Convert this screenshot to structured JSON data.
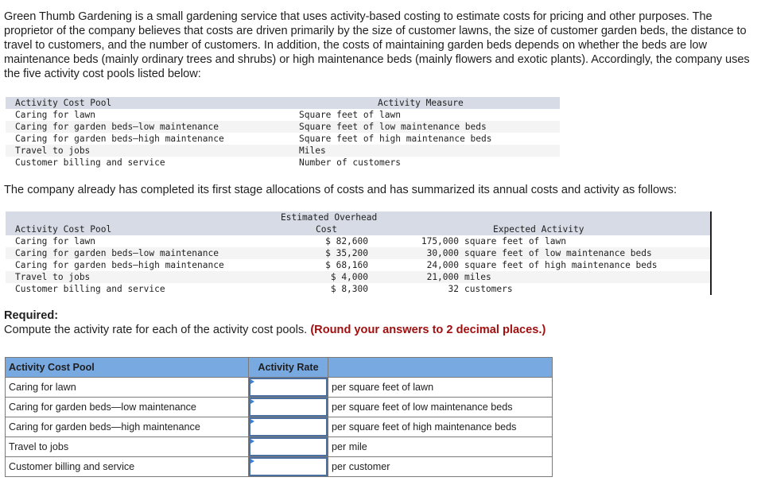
{
  "intro": {
    "paragraph": "Green Thumb Gardening is a small gardening service that uses activity-based costing to estimate costs for pricing and other purposes. The proprietor of the company believes that costs are driven primarily by the size of customer lawns, the size of customer garden beds, the distance to travel to customers, and the number of customers. In addition, the costs of maintaining garden beds depends on whether the beds are low maintenance beds (mainly ordinary trees and shrubs) or high maintenance beds (mainly flowers and exotic plants). Accordingly, the company uses the five activity cost pools listed below:"
  },
  "measures_table": {
    "headers": {
      "pool": "Activity Cost Pool",
      "measure": "Activity Measure"
    },
    "rows": [
      {
        "pool": "Caring for lawn",
        "measure": "Square feet of lawn"
      },
      {
        "pool": "Caring for garden beds–low maintenance",
        "measure": "Square feet of low maintenance beds"
      },
      {
        "pool": "Caring for garden beds–high maintenance",
        "measure": "Square feet of high maintenance beds"
      },
      {
        "pool": "Travel to jobs",
        "measure": "Miles"
      },
      {
        "pool": "Customer billing and service",
        "measure": "Number of customers"
      }
    ]
  },
  "paragraph2": "The company already has completed its first stage allocations of costs and has summarized its annual costs and activity as follows:",
  "costs_table": {
    "headers": {
      "pool": "Activity Cost Pool",
      "cost_line1": "Estimated Overhead",
      "cost_line2": "Cost",
      "activity": "Expected Activity"
    },
    "rows": [
      {
        "pool": "Caring for lawn",
        "cost": "$ 82,600",
        "qty": "175,000",
        "unit": "square feet of lawn"
      },
      {
        "pool": "Caring for garden beds–low maintenance",
        "cost": "$ 35,200",
        "qty": "30,000",
        "unit": "square feet of low maintenance beds"
      },
      {
        "pool": "Caring for garden beds–high maintenance",
        "cost": "$ 68,160",
        "qty": "24,000",
        "unit": "square feet of high maintenance beds"
      },
      {
        "pool": "Travel to jobs",
        "cost": "$ 4,000",
        "qty": "21,000",
        "unit": "miles"
      },
      {
        "pool": "Customer billing and service",
        "cost": "$ 8,300",
        "qty": "32",
        "unit": "customers"
      }
    ]
  },
  "required": {
    "label": "Required:",
    "instruction": "Compute the activity rate for each of the activity cost pools.",
    "note": "(Round your answers to 2 decimal places.)"
  },
  "answer_table": {
    "headers": {
      "pool": "Activity Cost Pool",
      "rate": "Activity Rate",
      "unit": ""
    },
    "rows": [
      {
        "pool": "Caring for lawn",
        "value": "",
        "unit": "per square feet of lawn"
      },
      {
        "pool": "Caring for garden beds—low maintenance",
        "value": "",
        "unit": "per square feet of low maintenance beds"
      },
      {
        "pool": "Caring for garden beds—high maintenance",
        "value": "",
        "unit": "per square feet of high maintenance beds"
      },
      {
        "pool": "Travel to jobs",
        "value": "",
        "unit": "per mile"
      },
      {
        "pool": "Customer billing and service",
        "value": "",
        "unit": "per customer"
      }
    ]
  }
}
